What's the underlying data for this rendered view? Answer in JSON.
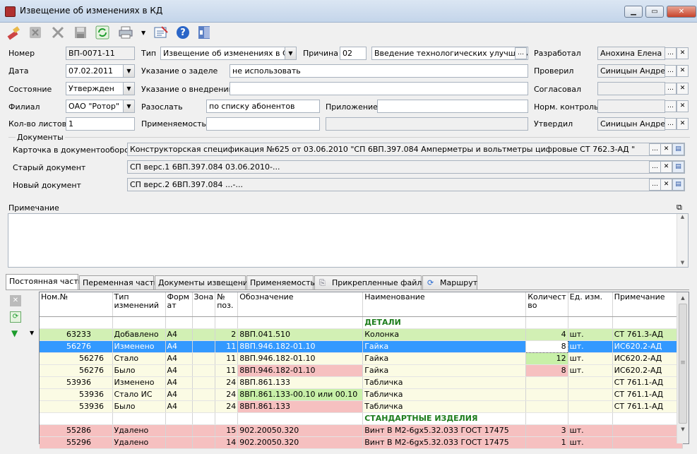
{
  "window": {
    "title": "Извещение об изменениях в КД"
  },
  "form": {
    "number_label": "Номер",
    "number": "ВП-0071-11",
    "type_label": "Тип",
    "type": "Извещение об изменениях в СП",
    "reason_label": "Причина",
    "reason_code": "02",
    "reason_text": "Введение технологических улучшений и",
    "developed_label": "Разработал",
    "developed": "Анохина Елена Ал",
    "date_label": "Дата",
    "date": "07.02.2011",
    "backlog_label": "Указание о заделе",
    "backlog": "не использовать",
    "checked_label": "Проверил",
    "checked": "Синицын Андрей",
    "state_label": "Состояние",
    "state": "Утвержден",
    "impl_label": "Указание о внедрении",
    "impl": "",
    "agreed_label": "Согласовал",
    "agreed": "",
    "branch_label": "Филиал",
    "branch": "ОАО \"Ротор\"",
    "send_label": "Разослать",
    "send": "по списку абонентов",
    "attach_label": "Приложение",
    "attach": "",
    "norm_label": "Норм. контроль",
    "norm": "",
    "sheets_label": "Кол-во листов",
    "sheets": "1",
    "applic_label": "Применяемость",
    "applic": "",
    "approved_label": "Утвердил",
    "approved": "Синицын  Андрей"
  },
  "docs": {
    "group_label": "Документы",
    "card_label": "Карточка в документообороте",
    "card": "Конструкторская спецификация №625  от 03.06.2010  \"СП 6ВП.397.084 Амперметры и вольтметры цифровые  СТ 762.3-АД \"",
    "old_label": "Старый документ",
    "old": "СП верс.1 6ВП.397.084 03.06.2010-...",
    "new_label": "Новый документ",
    "new": "СП верс.2 6ВП.397.084 ...-..."
  },
  "note": {
    "label": "Примечание",
    "text": ""
  },
  "tabs": [
    "Постоянная часть",
    "Переменная часть",
    "Документы извещения",
    "Применяемость",
    "Прикрепленные файлы",
    "Маршрут"
  ],
  "grid": {
    "headers": [
      "Ном.№",
      "Тип изменений",
      "Форм ат",
      "Зона",
      "№ поз.",
      "Обозначение",
      "Наименование",
      "Количест во",
      "Ед. изм.",
      "Примечание"
    ],
    "rows": [
      {
        "style": "w",
        "nom": "",
        "type": "",
        "fmt": "",
        "zone": "",
        "pos": "",
        "code": "",
        "name": "ДЕТАЛИ",
        "qty": "",
        "unit": "",
        "note": "",
        "section": true
      },
      {
        "style": "g",
        "nom": "63233",
        "type": "Добавлено",
        "fmt": "А4",
        "zone": "",
        "pos": "2",
        "code": "8ВП.041.510",
        "name": "Колонка",
        "qty": "4",
        "unit": "шт.",
        "note": "СТ 761.3-АД"
      },
      {
        "style": "sel",
        "nom": "56276",
        "type": "Изменено",
        "fmt": "А4",
        "zone": "",
        "pos": "11",
        "code": "8ВП.946.182-01.10",
        "name": "Гайка",
        "qty": "8",
        "unit": "шт.",
        "note": "ИС620.2-АД"
      },
      {
        "style": "y",
        "nom": "56276",
        "type": "Стало",
        "fmt": "А4",
        "zone": "",
        "pos": "11",
        "code": "8ВП.946.182-01.10",
        "name": "Гайка",
        "qty": "12",
        "unit": "шт.",
        "note": "ИС620.2-АД"
      },
      {
        "style": "y",
        "nom": "56276",
        "type": "Было",
        "fmt": "А4",
        "zone": "",
        "pos": "11",
        "code": "8ВП.946.182-01.10",
        "name": "Гайка",
        "qty": "8",
        "unit": "шт.",
        "note": "ИС620.2-АД"
      },
      {
        "style": "y",
        "nom": "53936",
        "type": "Изменено",
        "fmt": "А4",
        "zone": "",
        "pos": "24",
        "code": "8ВП.861.133",
        "name": "Табличка",
        "qty": "",
        "unit": "",
        "note": "СТ 761.1-АД"
      },
      {
        "style": "y",
        "nom": "53936",
        "type": "Стало   ИС",
        "fmt": "А4",
        "zone": "",
        "pos": "24",
        "code": "8ВП.861.133-00.10 или 00.10",
        "name": "Табличка",
        "qty": "",
        "unit": "",
        "note": "СТ 761.1-АД"
      },
      {
        "style": "y",
        "nom": "53936",
        "type": "Было",
        "fmt": "А4",
        "zone": "",
        "pos": "24",
        "code": "8ВП.861.133",
        "name": "Табличка",
        "qty": "",
        "unit": "",
        "note": "СТ 761.1-АД"
      },
      {
        "style": "w",
        "nom": "",
        "type": "",
        "fmt": "",
        "zone": "",
        "pos": "",
        "code": "",
        "name": "СТАНДАРТНЫЕ ИЗДЕЛИЯ",
        "qty": "",
        "unit": "",
        "note": "",
        "section": true
      },
      {
        "style": "r",
        "nom": "55286",
        "type": "Удалено",
        "fmt": "",
        "zone": "",
        "pos": "15",
        "code": "902.20050.320",
        "name": "Винт В М2-6gx5.32.033   ГОСТ 17475",
        "qty": "3",
        "unit": "шт.",
        "note": ""
      },
      {
        "style": "r",
        "nom": "55296",
        "type": "Удалено",
        "fmt": "",
        "zone": "",
        "pos": "14",
        "code": "902.20050.320",
        "name": "Винт В М2-6gx5.32.033   ГОСТ 17475",
        "qty": "1",
        "unit": "шт.",
        "note": ""
      }
    ]
  }
}
